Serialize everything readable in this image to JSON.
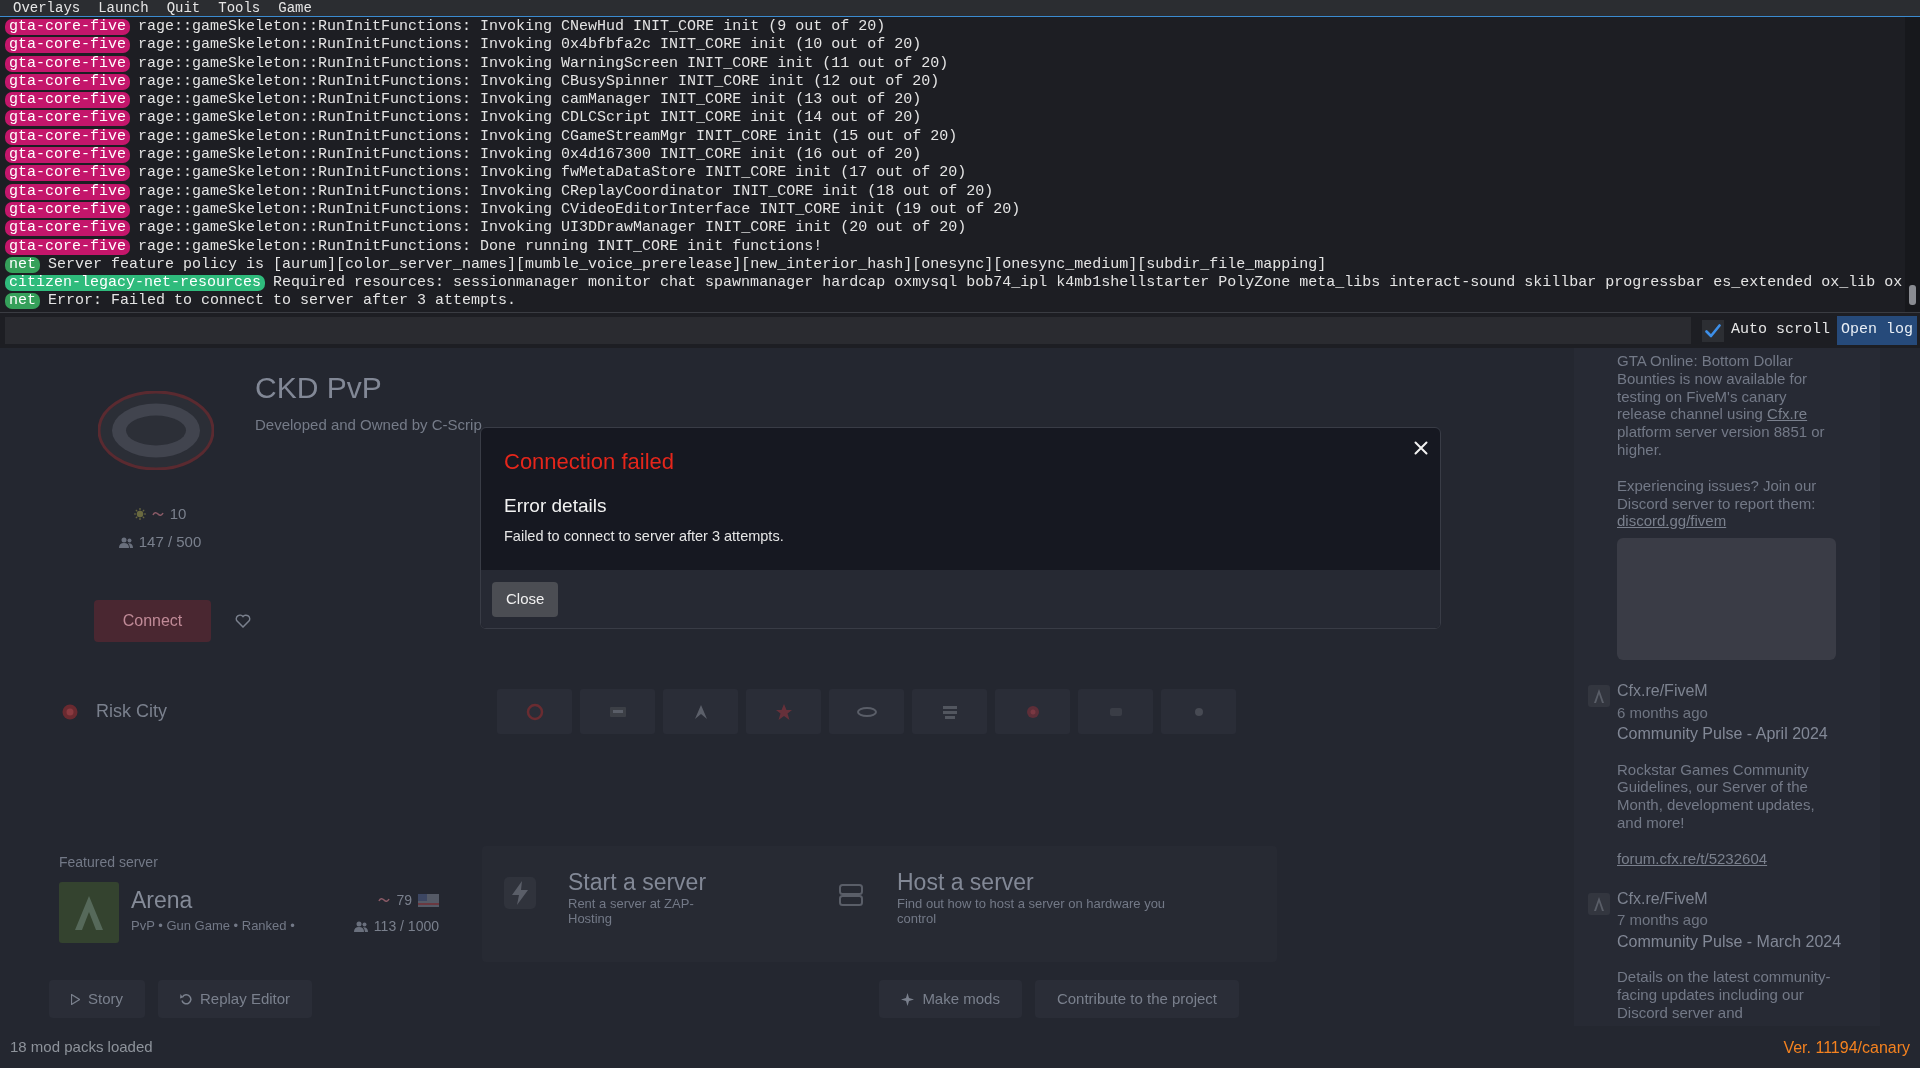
{
  "menu_bar": {
    "items": [
      "Overlays",
      "Launch",
      "Quit",
      "Tools",
      "Game"
    ]
  },
  "console": {
    "lines": [
      {
        "tag": "gta-core-five",
        "color": "#c4166b",
        "text": "rage::gameSkeleton::RunInitFunctions: Invoking CNewHud INIT_CORE init (9 out of 20)"
      },
      {
        "tag": "gta-core-five",
        "color": "#c4166b",
        "text": "rage::gameSkeleton::RunInitFunctions: Invoking 0x4bfbfa2c INIT_CORE init (10 out of 20)"
      },
      {
        "tag": "gta-core-five",
        "color": "#c4166b",
        "text": "rage::gameSkeleton::RunInitFunctions: Invoking WarningScreen INIT_CORE init (11 out of 20)"
      },
      {
        "tag": "gta-core-five",
        "color": "#c4166b",
        "text": "rage::gameSkeleton::RunInitFunctions: Invoking CBusySpinner INIT_CORE init (12 out of 20)"
      },
      {
        "tag": "gta-core-five",
        "color": "#c4166b",
        "text": "rage::gameSkeleton::RunInitFunctions: Invoking camManager INIT_CORE init (13 out of 20)"
      },
      {
        "tag": "gta-core-five",
        "color": "#c4166b",
        "text": "rage::gameSkeleton::RunInitFunctions: Invoking CDLCScript INIT_CORE init (14 out of 20)"
      },
      {
        "tag": "gta-core-five",
        "color": "#c4166b",
        "text": "rage::gameSkeleton::RunInitFunctions: Invoking CGameStreamMgr INIT_CORE init (15 out of 20)"
      },
      {
        "tag": "gta-core-five",
        "color": "#c4166b",
        "text": "rage::gameSkeleton::RunInitFunctions: Invoking 0x4d167300 INIT_CORE init (16 out of 20)"
      },
      {
        "tag": "gta-core-five",
        "color": "#c4166b",
        "text": "rage::gameSkeleton::RunInitFunctions: Invoking fwMetaDataStore INIT_CORE init (17 out of 20)"
      },
      {
        "tag": "gta-core-five",
        "color": "#c4166b",
        "text": "rage::gameSkeleton::RunInitFunctions: Invoking CReplayCoordinator INIT_CORE init (18 out of 20)"
      },
      {
        "tag": "gta-core-five",
        "color": "#c4166b",
        "text": "rage::gameSkeleton::RunInitFunctions: Invoking CVideoEditorInterface INIT_CORE init (19 out of 20)"
      },
      {
        "tag": "gta-core-five",
        "color": "#c4166b",
        "text": "rage::gameSkeleton::RunInitFunctions: Invoking UI3DDrawManager INIT_CORE init (20 out of 20)"
      },
      {
        "tag": "gta-core-five",
        "color": "#c4166b",
        "text": "rage::gameSkeleton::RunInitFunctions: Done running INIT_CORE init functions!"
      },
      {
        "tag": "net",
        "color": "#35a05a",
        "text": "Server feature policy is [aurum][color_server_names][mumble_voice_prerelease][new_interior_hash][onesync][onesync_medium][subdir_file_mapping]"
      },
      {
        "tag": "citizen-legacy-net-resources",
        "color": "#2fbb7c",
        "text": "Required resources: sessionmanager monitor chat spawnmanager hardcap oxmysql bob74_ipl k4mb1shellstarter PolyZone meta_libs interact-sound skillbar progressbar es_extended ox_lib ox"
      },
      {
        "tag": "net",
        "color": "#35a05a",
        "text": "Error: Failed to connect to server after 3 attempts."
      }
    ]
  },
  "auto_scroll": {
    "label": "Auto scroll",
    "checked": true
  },
  "open_log_button": {
    "label": "Open log"
  },
  "server": {
    "title": "CKD PvP",
    "description": "Developed and Owned by C-Scrip",
    "ping": "10",
    "players": "147 / 500",
    "connect": "Connect",
    "favorite": false
  },
  "server_row": {
    "name": "Risk City"
  },
  "featured": {
    "heading": "Featured server",
    "name": "Arena",
    "tags": "PvP • Gun Game • Ranked •",
    "ping": "79",
    "players": "113 / 1000"
  },
  "cards": [
    {
      "kind": "zap",
      "title": "Start a server",
      "text": "Rent a server at ZAP-Hosting"
    },
    {
      "kind": "host",
      "title": "Host a server",
      "text": "Find out how to host a server on hardware you control"
    }
  ],
  "actions_left": [
    {
      "kind": "story",
      "label": "Story"
    },
    {
      "kind": "replay",
      "label": "Replay Editor"
    }
  ],
  "actions_right": [
    {
      "kind": "mods",
      "label": "Make mods"
    },
    {
      "kind": "plain",
      "label": "Contribute to the project"
    }
  ],
  "feed": [
    {
      "kind": "paragraph",
      "parts": [
        {
          "text": "GTA Online: Bottom Dollar Bounties is now available for testing on FiveM's canary release channel using "
        },
        {
          "link": "Cfx.re"
        },
        {
          "text": " platform server version 8851 or higher."
        }
      ]
    },
    {
      "kind": "paragraph",
      "parts": [
        {
          "text": "Experiencing issues? Join our Discord server to report them: "
        },
        {
          "link": "discord.gg/fivem"
        }
      ]
    },
    {
      "kind": "image"
    },
    {
      "kind": "post",
      "author": "Cfx.re/FiveM",
      "time": "6 months ago",
      "title": "Community Pulse - April 2024"
    },
    {
      "kind": "paragraph",
      "parts": [
        {
          "text": "Rockstar Games Community Guidelines, our Server of the Month, development updates, and more!"
        }
      ]
    },
    {
      "kind": "paragraph",
      "parts": [
        {
          "link": "forum.cfx.re/t/5232604"
        }
      ]
    },
    {
      "kind": "post",
      "author": "Cfx.re/FiveM",
      "time": "7 months ago",
      "title": "Community Pulse - March 2024"
    },
    {
      "kind": "paragraph",
      "parts": [
        {
          "text": "Details on the latest community-facing updates including our Discord server and"
        }
      ]
    }
  ],
  "status_bar": {
    "left": "18 mod packs loaded",
    "version": "Ver. 11194/canary"
  },
  "modal": {
    "title": "Connection failed",
    "heading": "Error details",
    "message": "Failed to connect to server after 3 attempts.",
    "button": "Close"
  }
}
